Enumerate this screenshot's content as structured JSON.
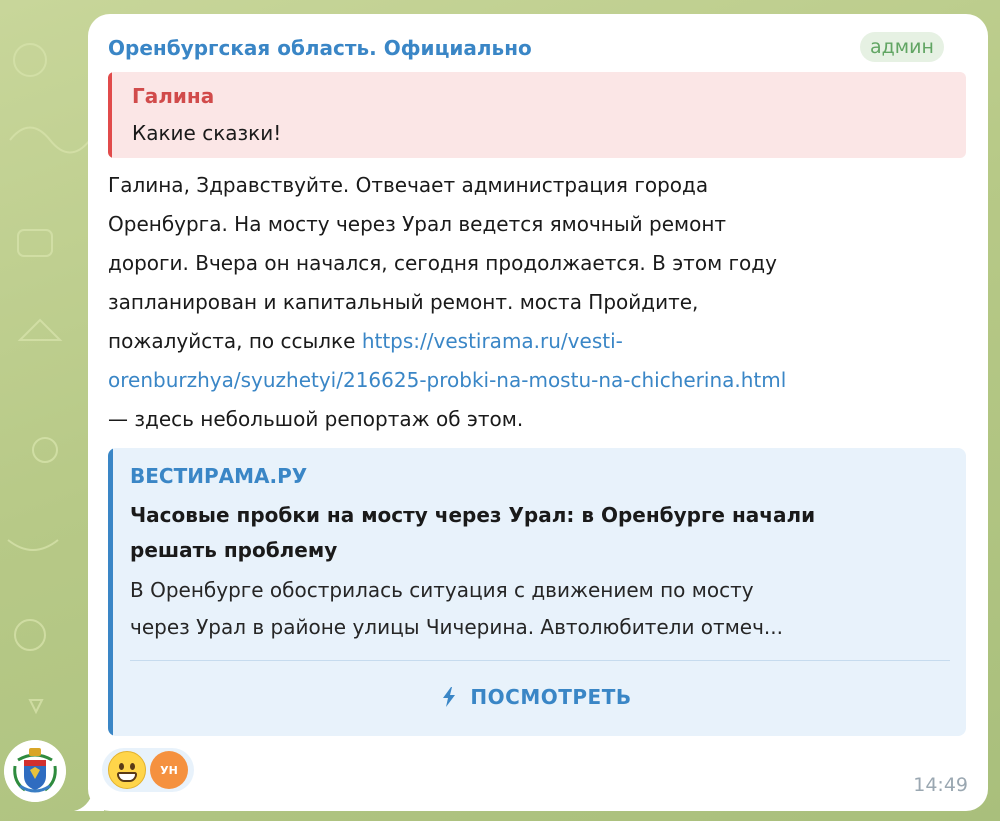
{
  "channel": {
    "name": "Оренбургская область. Официально",
    "badge": "админ"
  },
  "reply": {
    "author": "Галина",
    "text": "Какие сказки!"
  },
  "message": {
    "lines": [
      "Галина, Здравствуйте. Отвечает администрация города",
      "Оренбурга. На мосту через Урал ведется ямочный ремонт",
      "дороги. Вчера он начался, сегодня продолжается.  В этом году",
      "запланирован и капитальный ремонт. моста Пройдите,"
    ],
    "line5_prefix": "пожалуйста, по ссылке ",
    "link_part1": "https://vestirama.ru/vesti-",
    "link_part2": "orenburzhya/syuzhetyi/216625-probki-na-mostu-na-chicherina.html",
    "line7": "— здесь небольшой репортаж об этом."
  },
  "preview": {
    "site": "ВЕСТИРАМА.РУ",
    "title_lines": [
      "Часовые пробки на мосту через Урал: в Оренбурге начали",
      "решать проблему"
    ],
    "description_lines": [
      "В Оренбурге обострилась ситуация с движением по мосту",
      "через Урал в районе улицы Чичерина. Автолюбители отмеч..."
    ],
    "action_label": "ПОСМОТРЕТЬ",
    "action_icon": "lightning-icon"
  },
  "reactions": {
    "emoji": "grinning-face",
    "user_initials": "УН"
  },
  "time": "14:49",
  "colors": {
    "accent": "#3a86c6",
    "reply_accent": "#e14b4b",
    "admin_badge": "#61a563",
    "wallpaper": "#b7c987"
  }
}
